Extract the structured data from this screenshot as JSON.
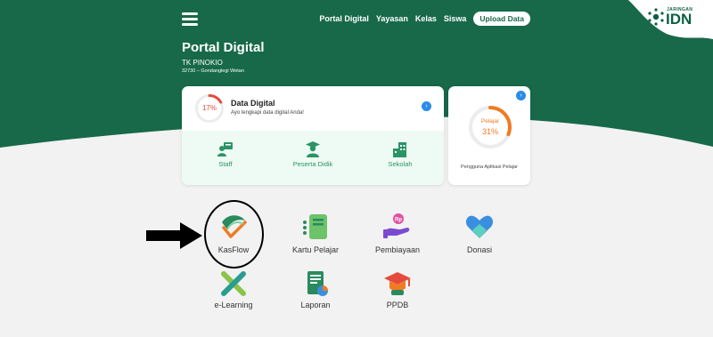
{
  "nav": {
    "links": [
      "Portal Digital",
      "Yayasan",
      "Kelas",
      "Siswa"
    ],
    "upload_label": "Upload Data"
  },
  "brand": {
    "small": "JARINGAN",
    "big": "IDN"
  },
  "school": {
    "title": "Portal Digital",
    "name": "TK PINOKIO",
    "address": "32730 – Gondanglegi Wetan"
  },
  "data_digital": {
    "percent_label": "17%",
    "percent": 17,
    "title": "Data Digital",
    "subtitle": "Ayo lengkapi data digital Anda!"
  },
  "stats": [
    {
      "label": "Staff",
      "icon": "staff-icon"
    },
    {
      "label": "Peserta Didik",
      "icon": "student-icon"
    },
    {
      "label": "Sekolah",
      "icon": "school-icon"
    }
  ],
  "pelajar": {
    "label": "Pelajar",
    "percent_label": "31%",
    "percent": 31,
    "caption": "Pengguna Aplikasi Pelajar"
  },
  "menu": [
    {
      "label": "KasFlow",
      "icon": "kasflow-icon"
    },
    {
      "label": "Kartu Pelajar",
      "icon": "student-card-icon"
    },
    {
      "label": "Pembiayaan",
      "icon": "payment-icon"
    },
    {
      "label": "Donasi",
      "icon": "donation-icon"
    },
    {
      "label": "e-Learning",
      "icon": "elearning-icon"
    },
    {
      "label": "Laporan",
      "icon": "report-icon"
    },
    {
      "label": "PPDB",
      "icon": "ppdb-icon"
    }
  ],
  "colors": {
    "primary_green": "#17694a",
    "accent_orange": "#f07b22",
    "accent_red": "#e44b3a",
    "light_green_bg": "#eefaf4"
  }
}
